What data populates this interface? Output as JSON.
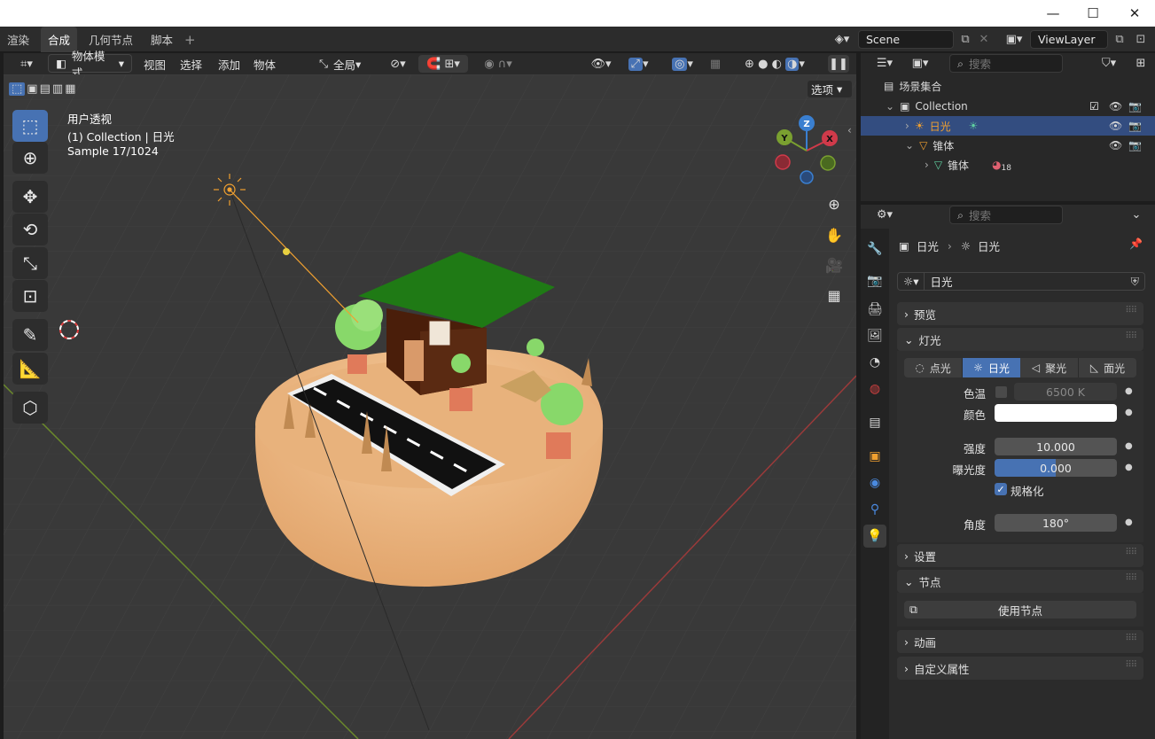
{
  "window": {
    "minimize": "—",
    "maximize": "☐",
    "close": "✕"
  },
  "topbar": {
    "workspaces": [
      "渲染",
      "合成",
      "几何节点",
      "脚本"
    ],
    "add_tab": "+",
    "scene": "Scene",
    "view_layer": "ViewLayer"
  },
  "viewport_header": {
    "mode": "物体模式",
    "menus": [
      "视图",
      "选择",
      "添加",
      "物体"
    ],
    "orientation": "全局",
    "options": "选项"
  },
  "viewport": {
    "view_name": "用户透视",
    "collection_line": "(1) Collection | 日光",
    "sample": "Sample 17/1024",
    "gizmo": {
      "z": "Z",
      "y": "Y",
      "x": "X"
    }
  },
  "outliner": {
    "search_placeholder": "搜索",
    "scene_collection": "场景集合",
    "collection": "Collection",
    "items": [
      {
        "name": "日光",
        "icon": "sun-light-icon"
      },
      {
        "name": "锥体",
        "icon": "cone-object-icon"
      },
      {
        "name": "锥体",
        "icon": "mesh-data-icon",
        "badge": "18"
      }
    ]
  },
  "properties": {
    "search_placeholder": "搜索",
    "breadcrumb_object": "日光",
    "breadcrumb_data": "日光",
    "datablock_name": "日光",
    "panels": {
      "preview": "预览",
      "light": "灯光",
      "settings": "设置",
      "nodes": "节点",
      "animation": "动画",
      "custom_props": "自定义属性"
    },
    "light_types": [
      "点光",
      "日光",
      "聚光",
      "面光"
    ],
    "active_light_type": "日光",
    "fields": {
      "temperature_label": "色温",
      "temperature_value": "6500 K",
      "color_label": "颜色",
      "color_value": "#ffffff",
      "strength_label": "强度",
      "strength_value": "10.000",
      "exposure_label": "曝光度",
      "exposure_value": "0.000",
      "normalize_label": "规格化",
      "angle_label": "角度",
      "angle_value": "180°"
    },
    "use_nodes": "使用节点"
  },
  "colors": {
    "accent": "#4772b3",
    "sun": "#f0a030",
    "mesh": "#5fd0a0"
  }
}
